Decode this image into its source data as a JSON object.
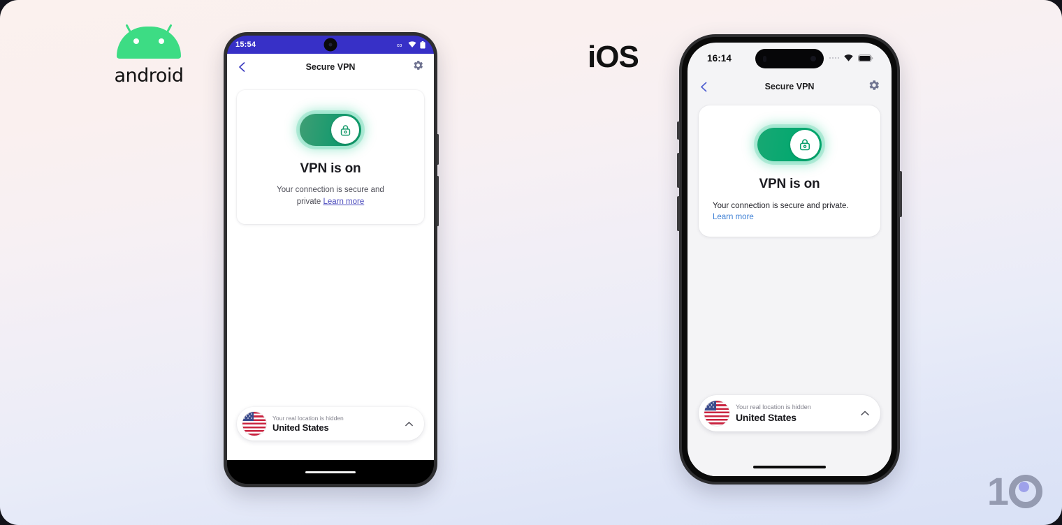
{
  "platforms": {
    "android_label": "android",
    "ios_label": "iOS"
  },
  "watermark": {
    "digit_one": "1",
    "accent_color": "#6c6ce0"
  },
  "android": {
    "status_bar": {
      "time": "15:54",
      "icons": [
        "signal-icon",
        "wifi-icon",
        "battery-icon"
      ]
    },
    "app_bar": {
      "back_icon": "back-chevron-icon",
      "title": "Secure VPN",
      "settings_icon": "gear-icon"
    },
    "card": {
      "toggle_state": "on",
      "toggle_icon": "lock-icon",
      "toggle_color": "#0f9d6b",
      "heading": "VPN is on",
      "description": "Your connection is secure and",
      "description_line2": "private ",
      "link_label": "Learn more",
      "link_color": "#4b4bbd"
    },
    "location_pill": {
      "flag_icon": "us-flag-icon",
      "hint": "Your real location is hidden",
      "country": "United States",
      "chevron_icon": "chevron-up-icon"
    },
    "nav": {
      "home_indicator": "home-indicator"
    }
  },
  "ios": {
    "status_bar": {
      "time": "16:14",
      "icons": [
        "signal-dots-icon",
        "wifi-icon",
        "battery-icon"
      ]
    },
    "app_bar": {
      "back_icon": "back-chevron-icon",
      "title": "Secure VPN",
      "settings_icon": "gear-icon"
    },
    "card": {
      "toggle_state": "on",
      "toggle_icon": "lock-icon",
      "toggle_color": "#00a96e",
      "heading": "VPN is on",
      "description": "Your connection is secure and private.",
      "link_label": "Learn more",
      "link_color": "#3d7fd4"
    },
    "location_pill": {
      "flag_icon": "us-flag-icon",
      "hint": "Your real location is hidden",
      "country": "United States",
      "chevron_icon": "chevron-up-icon"
    },
    "nav": {
      "home_indicator": "home-indicator"
    }
  }
}
